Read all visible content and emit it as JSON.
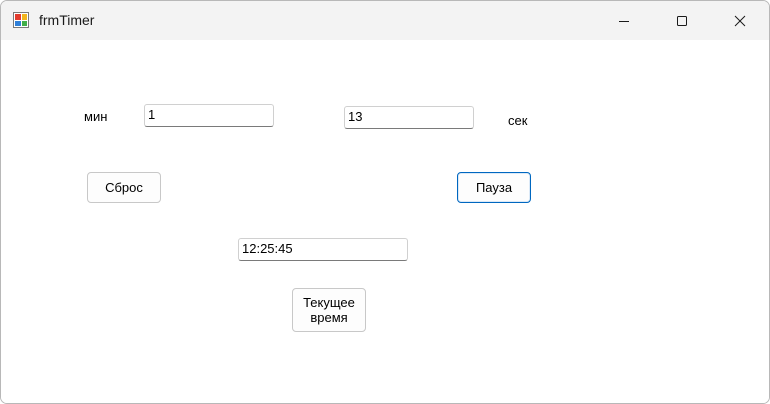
{
  "window": {
    "title": "frmTimer",
    "icon": "winforms-app-icon",
    "controls": {
      "minimize_icon": "minimize-icon",
      "maximize_icon": "maximize-icon",
      "close_icon": "close-icon"
    }
  },
  "form": {
    "minutes_label": "мин",
    "minutes_value": "1",
    "seconds_value": "13",
    "seconds_label": "сек",
    "reset_button": "Сброс",
    "pause_button": "Пауза",
    "current_time_value": "12:25:45",
    "current_time_button": "Текущее время"
  },
  "colors": {
    "titlebar_bg": "#f3f3f3",
    "accent": "#0067c0"
  }
}
